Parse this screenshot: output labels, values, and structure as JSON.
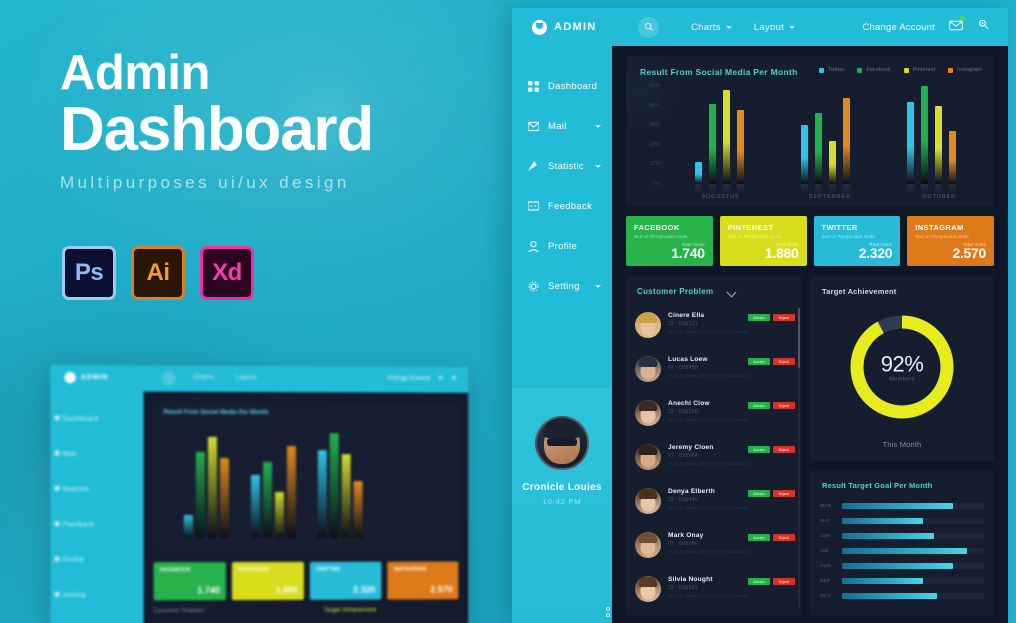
{
  "promo": {
    "title_line1": "Admin",
    "title_line2": "Dashboard",
    "subtitle": "Multipurposes ui/ux design",
    "adobe_icons": [
      {
        "label": "Ps",
        "name": "photoshop-icon"
      },
      {
        "label": "Ai",
        "name": "illustrator-icon"
      },
      {
        "label": "Xd",
        "name": "xd-icon"
      }
    ]
  },
  "header": {
    "logo_text": "ADMIN",
    "nav": [
      {
        "label": "Charts"
      },
      {
        "label": "Layout"
      }
    ],
    "change_account": "Change Account"
  },
  "sidebar": {
    "items": [
      {
        "label": "Dashboard",
        "icon": "grid-icon",
        "caret": false
      },
      {
        "label": "Mail",
        "icon": "mail-icon",
        "caret": true
      },
      {
        "label": "Statistic",
        "icon": "chart-icon",
        "caret": true
      },
      {
        "label": "Feedback",
        "icon": "feedback-icon",
        "caret": false
      },
      {
        "label": "Profile",
        "icon": "user-icon",
        "caret": false
      },
      {
        "label": "Setting",
        "icon": "gear-icon",
        "caret": true
      }
    ],
    "profile": {
      "name": "Cronicle Louies",
      "time": "10:42 PM"
    }
  },
  "chart_data": {
    "type": "bar",
    "title": "Result From Social Media Per Month",
    "categories": [
      "AUGUSTUS",
      "SEPTEMBER",
      "OCTOBER"
    ],
    "series": [
      {
        "name": "Twitter",
        "color": "#2ec5e8",
        "values": [
          11,
          30,
          42
        ]
      },
      {
        "name": "Facebook",
        "color": "#22b14c",
        "values": [
          41,
          36,
          50
        ]
      },
      {
        "name": "Pinterest",
        "color": "#d6dd2b",
        "values": [
          48,
          22,
          40
        ]
      },
      {
        "name": "Instagram",
        "color": "#e08b1e",
        "values": [
          38,
          44,
          27
        ]
      }
    ],
    "yticks": [
      "50%",
      "40%",
      "30%",
      "20%",
      "10%",
      "0%"
    ],
    "ylim": [
      0,
      50
    ],
    "ylabel": "",
    "xlabel": "",
    "grid": false,
    "legend_position": "top-right"
  },
  "stat_cards": [
    {
      "title": "FACEBOOK",
      "subtitle": "Sed Ut Perspiciatis Unde",
      "visits_label": "Total Visits",
      "value": "1.740",
      "color": "#27b24c"
    },
    {
      "title": "PINTEREST",
      "subtitle": "Sed Ut Perspiciatis Unde",
      "visits_label": "Total Visits",
      "value": "1.880",
      "color": "#d8dd1c"
    },
    {
      "title": "TWITTER",
      "subtitle": "Sed Ut Perspiciatis Unde",
      "visits_label": "Total Visits",
      "value": "2.320",
      "color": "#27bbd8"
    },
    {
      "title": "INSTAGRAM",
      "subtitle": "Sed Ut Perspiciatis Unde",
      "visits_label": "Total Visits",
      "value": "2.570",
      "color": "#de7a19"
    }
  ],
  "customer_problem": {
    "title": "Customer Problem",
    "accept_label": "Accept",
    "reject_label": "Reject",
    "rows": [
      {
        "name": "Cinere Ella",
        "id": "ID : 098121",
        "desc": "Ut Enim Ipsam Dolor Sit Amet Consectetur",
        "hair": "#caa24a",
        "skin": "#e6c0a0"
      },
      {
        "name": "Lucas Loew",
        "id": "ID : 098455",
        "desc": "Ut Enim Ipsam Dolor Sit Amet Consectetur",
        "hair": "#26303f",
        "skin": "#dcb295"
      },
      {
        "name": "Anechi Clow",
        "id": "ID : 098298",
        "desc": "Ut Enim Ipsam Dolor Sit Amet Consectetur",
        "hair": "#3c2a22",
        "skin": "#e8c3a4"
      },
      {
        "name": "Jeremy Cloen",
        "id": "ID : 098864",
        "desc": "Ut Enim Ipsam Dolor Sit Amet Consectetur",
        "hair": "#2b2219",
        "skin": "#d9ab85"
      },
      {
        "name": "Denya Elberth",
        "id": "ID : 098449",
        "desc": "Ut Enim Ipsam Dolor Sit Amet Consectetur",
        "hair": "#4a2e1c",
        "skin": "#eac6a7"
      },
      {
        "name": "Mark Onay",
        "id": "ID : 098090",
        "desc": "Ut Enim Ipsam Dolor Sit Amet Consectetur",
        "hair": "#6d5033",
        "skin": "#e3b896"
      },
      {
        "name": "Silvia Nought",
        "id": "ID : 098561",
        "desc": "Ut Enim Ipsam Dolor Sit Amet Consectetur",
        "hair": "#5a3a24",
        "skin": "#eccaa9"
      }
    ]
  },
  "target_achievement": {
    "title": "Target Achievement",
    "percent": "92%",
    "percent_value": 92,
    "sub_label": "Members",
    "footer": "This Month",
    "ring_color": "#e6ec1e",
    "track_color": "#333c4f"
  },
  "goal_chart": {
    "type": "bar",
    "title": "Result Target Goal Per Month",
    "orientation": "horizontal",
    "categories": [
      "MAR",
      "MAY",
      "JUN",
      "JUL",
      "AUG",
      "SEP",
      "OCT"
    ],
    "values": [
      78,
      57,
      65,
      88,
      78,
      57,
      67
    ],
    "ylim": [
      0,
      100
    ]
  },
  "mockup": {
    "logo_text": "ADMIN",
    "nav": [
      "Charts",
      "Layout"
    ],
    "change_account": "Change Account",
    "sidebar_items": [
      "Dashboard",
      "Mail",
      "Statistic",
      "Feedback",
      "Profile",
      "Setting"
    ],
    "chart_title": "Result From Social Media Per Month",
    "cards": [
      {
        "title": "FACEBOOK",
        "value": "1.740",
        "color": "#27b24c"
      },
      {
        "title": "PINTEREST",
        "value": "1.880",
        "color": "#d8dd1c"
      },
      {
        "title": "TWITTER",
        "value": "2.320",
        "color": "#27bbd8"
      },
      {
        "title": "INSTAGRAM",
        "value": "2.570",
        "color": "#de7a19"
      }
    ],
    "footer_left": "Customer Problem",
    "footer_right": "Target Achievement"
  }
}
